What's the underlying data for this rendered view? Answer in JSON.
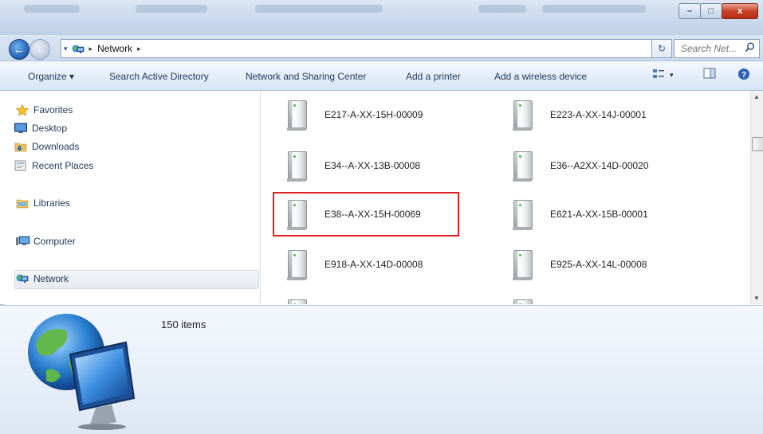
{
  "window": {
    "minimize_glyph": "–",
    "maximize_glyph": "□",
    "close_glyph": "x"
  },
  "address": {
    "back_glyph": "←",
    "forward_glyph": "→",
    "crumb_separator": "▸",
    "location": "Network",
    "refresh_glyph": "↻",
    "search_placeholder": "Search Net..."
  },
  "toolbar": {
    "organize": "Organize ▾",
    "search_ad": "Search Active Directory",
    "network_sharing": "Network and Sharing Center",
    "add_printer": "Add a printer",
    "add_wireless": "Add a wireless device",
    "view_dropdown_glyph": "▾"
  },
  "nav": {
    "favorites": "Favorites",
    "desktop": "Desktop",
    "downloads": "Downloads",
    "recent_places": "Recent Places",
    "libraries": "Libraries",
    "computer": "Computer",
    "network": "Network"
  },
  "computers": [
    "E217-A-XX-15H-00009",
    "E223-A-XX-14J-00001",
    "E34--A-XX-13B-00008",
    "E36--A2XX-14D-00020",
    "E38--A-XX-15H-00069",
    "E621-A-XX-15B-00001",
    "E918-A-XX-14D-00008",
    "E925-A-XX-14L-00008"
  ],
  "details": {
    "item_count": "150 items"
  },
  "colors": {
    "highlight_border": "#e02020",
    "close_button": "#c8442a",
    "toolbar_text": "#1e395b"
  }
}
